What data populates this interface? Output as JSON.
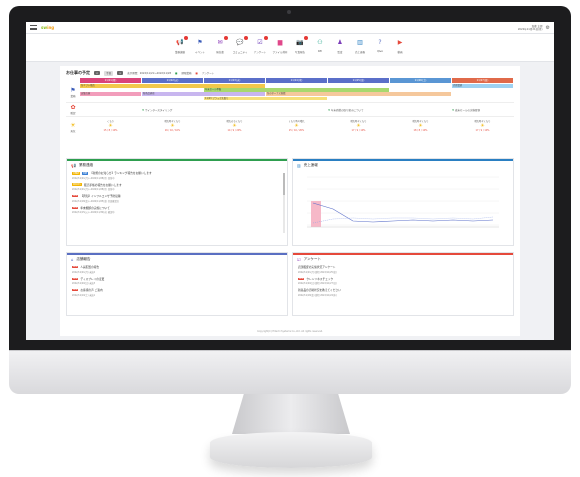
{
  "app": {
    "logo_left": "sw",
    "logo_right": "ing",
    "user_name": "加藤 太郎",
    "user_datetime": "2022年11月21日(月)"
  },
  "nav": [
    {
      "name": "nav-announce",
      "icon": "megaphone-icon",
      "glyph": "📢",
      "color": "#2e9e4f",
      "label": "業務連絡",
      "badge": true
    },
    {
      "name": "nav-event",
      "icon": "flag-icon",
      "glyph": "⚑",
      "color": "#3a5bb8",
      "label": "イベント",
      "badge": false
    },
    {
      "name": "nav-report",
      "icon": "mail-icon",
      "glyph": "✉",
      "color": "#8b3ab8",
      "label": "報告書",
      "badge": true
    },
    {
      "name": "nav-community",
      "icon": "chat-icon",
      "glyph": "💬",
      "color": "#e07a1f",
      "label": "コミュニティ",
      "badge": true
    },
    {
      "name": "nav-survey",
      "icon": "checklist-icon",
      "glyph": "☑",
      "color": "#6a3ab8",
      "label": "アンケート",
      "badge": true
    },
    {
      "name": "nav-files",
      "icon": "folder-icon",
      "glyph": "▆",
      "color": "#e0478a",
      "label": "ファイル共有",
      "badge": false
    },
    {
      "name": "nav-photo",
      "icon": "camera-icon",
      "glyph": "📷",
      "color": "#2a7fc2",
      "label": "写真報告",
      "badge": true
    },
    {
      "name": "nav-kpi",
      "icon": "kpi-icon",
      "glyph": "⚇",
      "color": "#17a085",
      "label": "KPI",
      "badge": false
    },
    {
      "name": "nav-audit",
      "icon": "inspector-icon",
      "glyph": "♟",
      "color": "#7a3ab8",
      "label": "監査",
      "badge": false
    },
    {
      "name": "nav-sales",
      "icon": "bar-chart-icon",
      "glyph": "▥",
      "color": "#2a7fc2",
      "label": "売上速報",
      "badge": false
    },
    {
      "name": "nav-faq",
      "icon": "question-icon",
      "glyph": "?",
      "color": "#5a6fc2",
      "label": "Q&A",
      "badge": false
    },
    {
      "name": "nav-video",
      "icon": "play-icon",
      "glyph": "▶",
      "color": "#e5493b",
      "label": "動画",
      "badge": false
    }
  ],
  "schedule": {
    "title": "お仕事の予定",
    "btn_prev": "<",
    "btn_today": "今日",
    "btn_next": ">",
    "period": "表示期間：2022/11/21〜2022/11/28",
    "legend_a": "期限業務",
    "legend_b": "アンケート",
    "row_labels": {
      "events": "業務",
      "sales": "販促",
      "weather": "天気"
    },
    "days": [
      {
        "label": "11/21(月)",
        "kind": "today"
      },
      {
        "label": "11/22(火)",
        "kind": "normal"
      },
      {
        "label": "11/23(水)",
        "kind": "normal"
      },
      {
        "label": "11/24(木)",
        "kind": "normal"
      },
      {
        "label": "11/25(金)",
        "kind": "normal"
      },
      {
        "label": "11/26(土)",
        "kind": "sat"
      },
      {
        "label": "11/27(日)",
        "kind": "sun"
      }
    ],
    "chips": [
      {
        "text": "冬ギフト販売",
        "day": 0,
        "span": 3,
        "row": 0,
        "color": "#f2c84b"
      },
      {
        "text": "年末セール準備",
        "day": 2,
        "span": 3,
        "row": 1,
        "color": "#a8d86e"
      },
      {
        "text": "店舗点検",
        "day": 0,
        "span": 1,
        "row": 2,
        "color": "#f29dbb"
      },
      {
        "text": "新商品研修",
        "day": 1,
        "span": 2,
        "row": 2,
        "color": "#c8b6ef"
      },
      {
        "text": "冬のボーナス商戦",
        "day": 3,
        "span": 3,
        "row": 2,
        "color": "#f5c89c"
      },
      {
        "text": "売場変更",
        "day": 6,
        "span": 1,
        "row": 0,
        "color": "#9ed2f2"
      },
      {
        "text": "11/23 ブラック先取り",
        "day": 2,
        "span": 2,
        "row": 3,
        "color": "#f7e07a"
      }
    ],
    "sales_events": [
      {
        "day": 1,
        "text": "ウインタースタイリング"
      },
      {
        "day": 4,
        "text": "年末商戦の取り組みについて"
      },
      {
        "day": 6,
        "text": "歳末セールの実施要領"
      }
    ],
    "weather": [
      {
        "desc": "くもり",
        "temp": "15 / 8 / 10%"
      },
      {
        "desc": "晴れ時々くもり",
        "temp": "16 / 10 / 10%"
      },
      {
        "desc": "晴れのちくもり",
        "temp": "14 / 9 / 20%"
      },
      {
        "desc": "くもり時々晴れ",
        "temp": "15 / 10 / 20%"
      },
      {
        "desc": "晴れ時々くもり",
        "temp": "17 / 9 / 10%"
      },
      {
        "desc": "晴れ時々くもり",
        "temp": "18 / 8 / 10%"
      },
      {
        "desc": "晴れ時々くもり",
        "temp": "17 / 9 / 10%"
      }
    ]
  },
  "announcements": {
    "title": "業務連絡",
    "items": [
      {
        "tag": "未確認",
        "tag_color": "#f2b400",
        "tag2": "重要",
        "title": "【新規のお知らせ】ランキング報告をお願いします",
        "date": "2022/11/21(月)〜2022/11/28(月) 回答中"
      },
      {
        "tag": "回答待ち",
        "tag_color": "#f2b400",
        "tag2": "",
        "title": "販売手帳の報告をお願いします",
        "date": "2022/11/21(月)〜2022/11/28(月) 回答中"
      },
      {
        "tag": "New",
        "tag_color": "#e5493b",
        "tag2": "",
        "title": "【周知】インフルエンザ予防接種",
        "date": "2022/11/18(金)〜2022/11/25(金) 全員確認済"
      },
      {
        "tag": "New",
        "tag_color": "#e5493b",
        "tag2": "",
        "title": "年末棚卸の実施について",
        "date": "2022/11/15(火)〜2022/11/30(水) 確認中"
      }
    ]
  },
  "sales_flash": {
    "title": "売上速報"
  },
  "store_reports": {
    "title": "店舗報告",
    "items": [
      {
        "tag": "New",
        "title": "人員配置の報告",
        "date": "2022/11/21(月) 未読2"
      },
      {
        "tag": "New",
        "title": "ディスプレイの変更",
        "date": "2022/11/20(日) 未読3"
      },
      {
        "tag": "New",
        "title": "お客様の声 ご案内",
        "date": "2022/11/19(土) 未読1"
      }
    ]
  },
  "surveys": {
    "title": "アンケート",
    "items": [
      {
        "title": "店頭販促の実施状況アンケート",
        "date": "2022/11/21(月) 締切 2022/11/25(金)"
      },
      {
        "tag": "New",
        "title": "クレンリネスチェック",
        "date": "2022/11/20(日) 締切 2022/11/27(日)"
      },
      {
        "title": "新商品の売場状況を教えてください",
        "date": "2022/11/18(金) 締切 2022/11/24(木)"
      }
    ]
  },
  "footer": "Copyright(C) Hitachi Systems Co.,Ltd. All rights reserved."
}
